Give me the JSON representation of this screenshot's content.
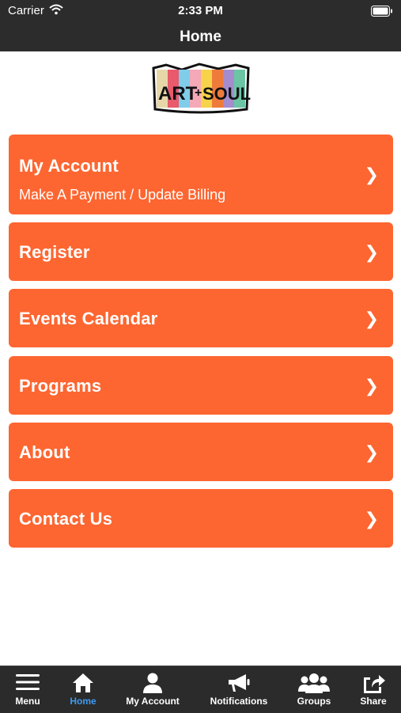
{
  "status_bar": {
    "carrier": "Carrier",
    "time": "2:33 PM"
  },
  "nav": {
    "title": "Home"
  },
  "logo": {
    "text_left": "ART",
    "text_plus": "+",
    "text_right": "SOUL"
  },
  "menu": [
    {
      "title": "My Account",
      "subtitle": "Make A Payment / Update Billing",
      "chevron": "❯"
    },
    {
      "title": "Register",
      "chevron": "❯"
    },
    {
      "title": "Events Calendar",
      "chevron": "❯"
    },
    {
      "title": "Programs",
      "chevron": "❯"
    },
    {
      "title": "About",
      "chevron": "❯"
    },
    {
      "title": "Contact Us",
      "chevron": "❯"
    }
  ],
  "tabs": [
    {
      "label": "Menu",
      "icon": "hamburger-icon"
    },
    {
      "label": "Home",
      "icon": "home-icon",
      "active": true
    },
    {
      "label": "My Account",
      "icon": "user-icon"
    },
    {
      "label": "Notifications",
      "icon": "megaphone-icon"
    },
    {
      "label": "Groups",
      "icon": "group-icon"
    },
    {
      "label": "Share",
      "icon": "share-icon"
    }
  ],
  "colors": {
    "accent": "#fd6631",
    "bar": "#2c2c2c",
    "active_tab": "#3c9bf4"
  }
}
